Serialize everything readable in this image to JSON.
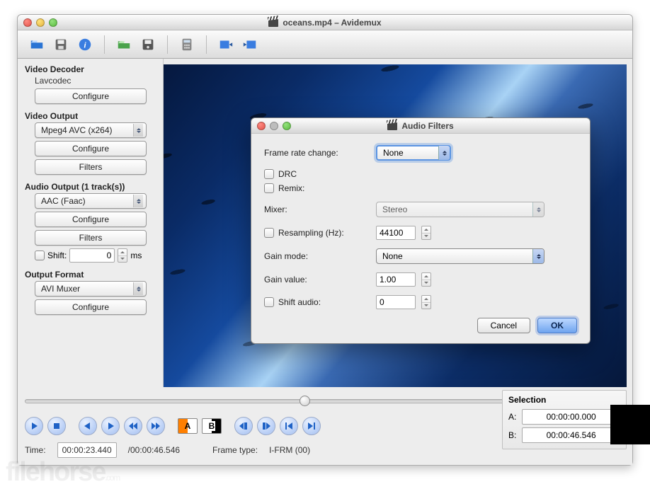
{
  "window": {
    "title": "oceans.mp4 – Avidemux"
  },
  "sidebar": {
    "video_decoder": {
      "heading": "Video Decoder",
      "codec": "Lavcodec",
      "configure": "Configure"
    },
    "video_output": {
      "heading": "Video Output",
      "select": "Mpeg4 AVC (x264)",
      "configure": "Configure",
      "filters": "Filters"
    },
    "audio_output": {
      "heading": "Audio Output (1 track(s))",
      "select": "AAC (Faac)",
      "configure": "Configure",
      "filters": "Filters",
      "shift_label": "Shift:",
      "shift_value": "0",
      "shift_unit": "ms"
    },
    "output_format": {
      "heading": "Output Format",
      "select": "AVI Muxer",
      "configure": "Configure"
    }
  },
  "status": {
    "time_label": "Time:",
    "time_current": "00:00:23.440",
    "time_total": "/00:00:46.546",
    "frame_type_label": "Frame type:",
    "frame_type": "I-FRM (00)"
  },
  "selection": {
    "title": "Selection",
    "a_label": "A:",
    "a_value": "00:00:00.000",
    "b_label": "B:",
    "b_value": "00:00:46.546"
  },
  "dialog": {
    "title": "Audio Filters",
    "frame_rate_label": "Frame rate change:",
    "frame_rate_value": "None",
    "drc": "DRC",
    "remix": "Remix:",
    "mixer_label": "Mixer:",
    "mixer_value": "Stereo",
    "resampling_label": "Resampling (Hz):",
    "resampling_value": "44100",
    "gain_mode_label": "Gain mode:",
    "gain_mode_value": "None",
    "gain_value_label": "Gain value:",
    "gain_value": "1.00",
    "shift_audio_label": "Shift audio:",
    "shift_audio_value": "0",
    "cancel": "Cancel",
    "ok": "OK"
  },
  "watermark": "filehorse.com"
}
